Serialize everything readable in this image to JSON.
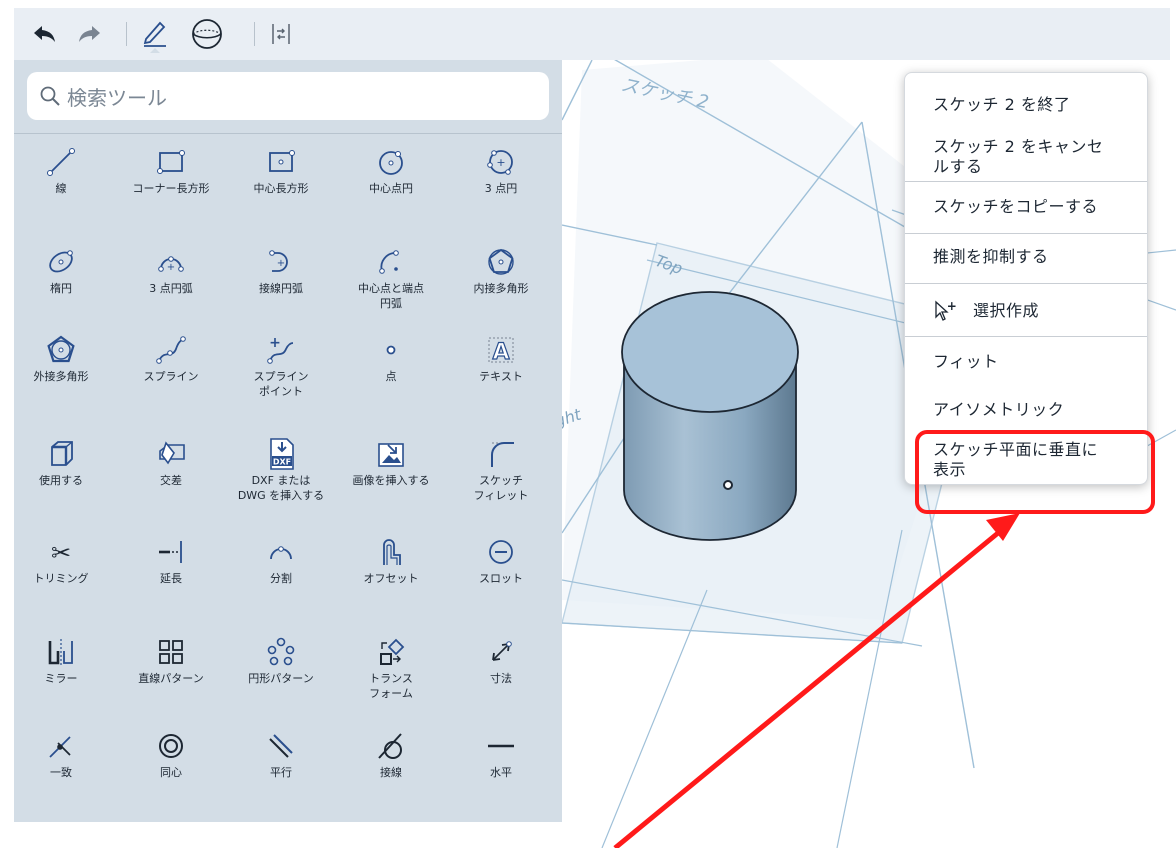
{
  "toolbar": {
    "items": [
      {
        "icon": "undo-icon"
      },
      {
        "icon": "redo-icon"
      },
      {
        "icon": "pencil-sketch-icon"
      },
      {
        "icon": "view-cube-icon"
      },
      {
        "icon": "constraint-panel-icon"
      }
    ]
  },
  "search": {
    "placeholder": "検索ツール"
  },
  "tools": [
    {
      "label": "線",
      "icon": "line-icon"
    },
    {
      "label": "コーナー長方形",
      "icon": "corner-rectangle-icon"
    },
    {
      "label": "中心長方形",
      "icon": "center-rectangle-icon"
    },
    {
      "label": "中心点円",
      "icon": "center-circle-icon"
    },
    {
      "label": "3 点円",
      "icon": "three-point-circle-icon"
    },
    {
      "label": "楕円",
      "icon": "ellipse-icon"
    },
    {
      "label": "3 点円弧",
      "icon": "three-point-arc-icon"
    },
    {
      "label": "接線円弧",
      "icon": "tangent-arc-icon"
    },
    {
      "label": "中心点と端点\n円弧",
      "icon": "center-point-arc-icon"
    },
    {
      "label": "内接多角形",
      "icon": "inscribed-polygon-icon"
    },
    {
      "label": "外接多角形",
      "icon": "circumscribed-polygon-icon"
    },
    {
      "label": "スプライン",
      "icon": "spline-icon"
    },
    {
      "label": "スプライン\nポイント",
      "icon": "spline-point-icon"
    },
    {
      "label": "点",
      "icon": "point-icon"
    },
    {
      "label": "テキスト",
      "icon": "text-icon"
    },
    {
      "label": "使用する",
      "icon": "use-icon"
    },
    {
      "label": "交差",
      "icon": "intersect-icon"
    },
    {
      "label": "DXF または\nDWG を挿入する",
      "icon": "insert-dxf-icon"
    },
    {
      "label": "画像を挿入する",
      "icon": "insert-image-icon"
    },
    {
      "label": "スケッチ\nフィレット",
      "icon": "sketch-fillet-icon"
    },
    {
      "label": "トリミング",
      "icon": "trim-icon"
    },
    {
      "label": "延長",
      "icon": "extend-icon"
    },
    {
      "label": "分割",
      "icon": "split-icon"
    },
    {
      "label": "オフセット",
      "icon": "offset-icon"
    },
    {
      "label": "スロット",
      "icon": "slot-icon"
    },
    {
      "label": "ミラー",
      "icon": "mirror-icon"
    },
    {
      "label": "直線パターン",
      "icon": "linear-pattern-icon"
    },
    {
      "label": "円形パターン",
      "icon": "circular-pattern-icon"
    },
    {
      "label": "トランス\nフォーム",
      "icon": "transform-icon"
    },
    {
      "label": "寸法",
      "icon": "dimension-icon"
    },
    {
      "label": "一致",
      "icon": "coincident-icon"
    },
    {
      "label": "同心",
      "icon": "concentric-icon"
    },
    {
      "label": "平行",
      "icon": "parallel-icon"
    },
    {
      "label": "接線",
      "icon": "tangent-icon"
    },
    {
      "label": "水平",
      "icon": "horizontal-icon"
    }
  ],
  "viewport": {
    "plane_labels": {
      "sketch": "スケッチ 2",
      "top": "Top",
      "right": "Right"
    }
  },
  "context_menu": {
    "items": [
      {
        "label": "スケッチ 2 を終了"
      },
      {
        "label": "スケッチ 2 をキャンセ\nルする"
      },
      {
        "label": "スケッチをコピーする"
      },
      {
        "label": "推測を抑制する"
      },
      {
        "label": "選択作成",
        "icon": "cursor-plus-icon"
      },
      {
        "label": "フィット"
      },
      {
        "label": "アイソメトリック"
      },
      {
        "label": "スケッチ平面に垂直に\n表示"
      }
    ]
  },
  "colors": {
    "toolbar_bg": "#e9eef4",
    "panel_bg": "#d3dde6",
    "icon_blue": "#2a4f8e",
    "plane_line": "#9fc0d8",
    "cylinder": "#8fafc6",
    "annotation_red": "#ff1a1a"
  }
}
